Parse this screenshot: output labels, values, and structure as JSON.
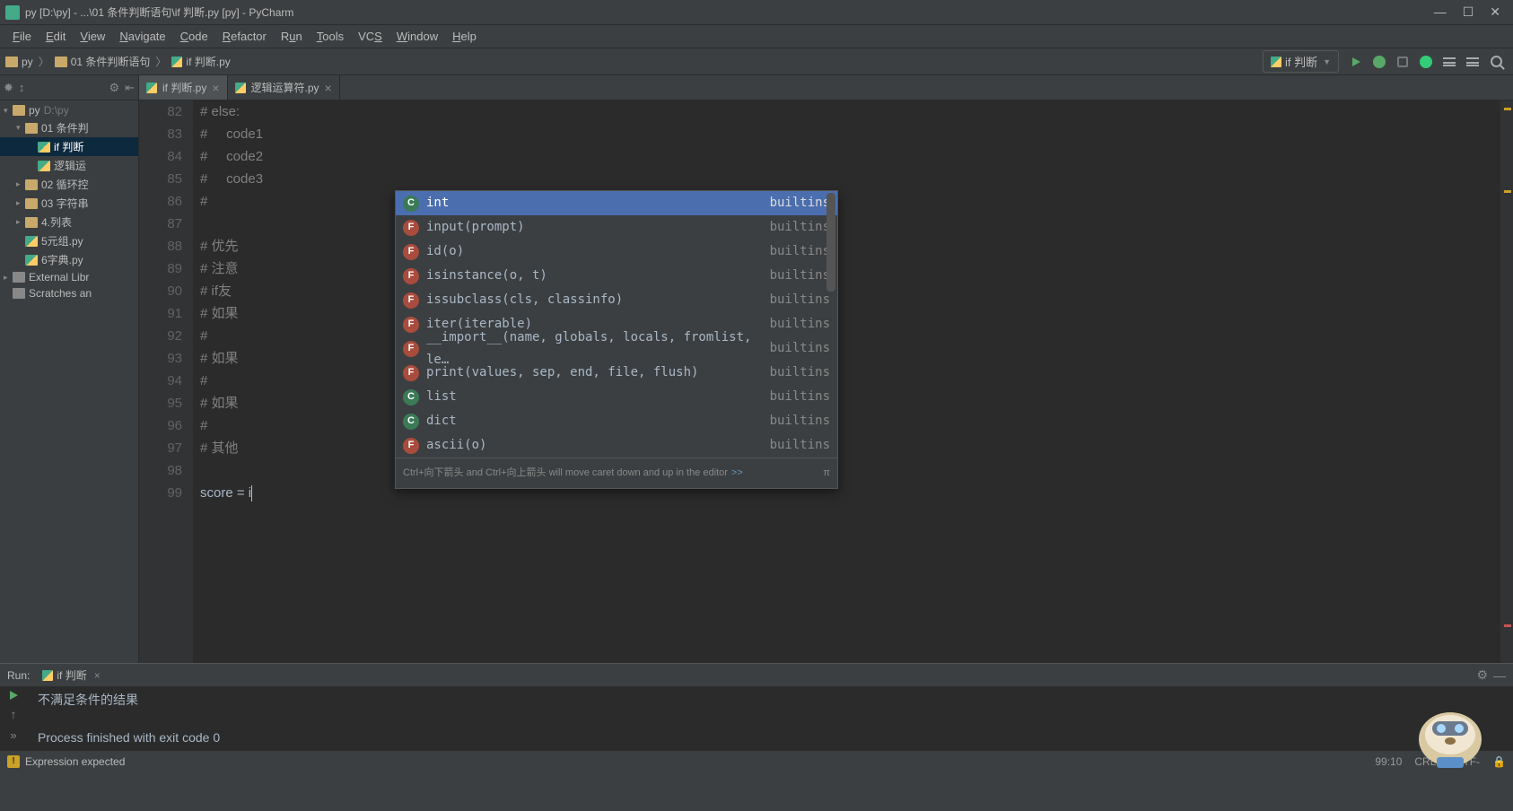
{
  "window": {
    "title": "py [D:\\py] - ...\\01 条件判断语句\\if 判断.py [py] - PyCharm"
  },
  "menu": [
    "File",
    "Edit",
    "View",
    "Navigate",
    "Code",
    "Refactor",
    "Run",
    "Tools",
    "VCS",
    "Window",
    "Help"
  ],
  "breadcrumbs": [
    "py",
    "01 条件判断语句",
    "if 判断.py"
  ],
  "run_config": "if 判断",
  "tabs": [
    {
      "name": "if 判断.py",
      "active": true
    },
    {
      "name": "逻辑运算符.py",
      "active": false
    }
  ],
  "project_tree": [
    {
      "level": 0,
      "kind": "folder",
      "label": "py",
      "dim": "D:\\py",
      "chev": "▾"
    },
    {
      "level": 1,
      "kind": "folder",
      "label": "01 条件判",
      "chev": "▾"
    },
    {
      "level": 2,
      "kind": "pyfile",
      "label": "if 判断",
      "selected": true
    },
    {
      "level": 2,
      "kind": "pyfile",
      "label": "逻辑运"
    },
    {
      "level": 1,
      "kind": "folder",
      "label": "02 循环控",
      "chev": "▸"
    },
    {
      "level": 1,
      "kind": "folder",
      "label": "03 字符串",
      "chev": "▸"
    },
    {
      "level": 1,
      "kind": "folder",
      "label": "4.列表",
      "chev": "▸"
    },
    {
      "level": 1,
      "kind": "pyfile",
      "label": "5元组.py"
    },
    {
      "level": 1,
      "kind": "pyfile",
      "label": "6字典.py"
    },
    {
      "level": 0,
      "kind": "lib",
      "label": "External Libr",
      "chev": "▸"
    },
    {
      "level": 0,
      "kind": "lib",
      "label": "Scratches an"
    }
  ],
  "gutter_start": 82,
  "code_lines": [
    "# else:",
    "#     code1",
    "#     code2",
    "#     code3",
    "#",
    "",
    "# 优先",
    "# 注意",
    "# if友",
    "# 如果",
    "#",
    "# 如果",
    "#",
    "# 如果",
    "#",
    "# 其他",
    "",
    "score = i"
  ],
  "completion": {
    "selected_index": 0,
    "items": [
      {
        "kind": "c",
        "name": "int",
        "src": "builtins"
      },
      {
        "kind": "f",
        "name": "input(prompt)",
        "src": "builtins"
      },
      {
        "kind": "f",
        "name": "id(o)",
        "src": "builtins"
      },
      {
        "kind": "f",
        "name": "isinstance(o, t)",
        "src": "builtins"
      },
      {
        "kind": "f",
        "name": "issubclass(cls, classinfo)",
        "src": "builtins"
      },
      {
        "kind": "f",
        "name": "iter(iterable)",
        "src": "builtins"
      },
      {
        "kind": "f",
        "name": "__import__(name, globals, locals, fromlist, le…",
        "src": "builtins"
      },
      {
        "kind": "f",
        "name": "print(values, sep, end, file, flush)",
        "src": "builtins"
      },
      {
        "kind": "c",
        "name": "list",
        "src": "builtins"
      },
      {
        "kind": "c",
        "name": "dict",
        "src": "builtins"
      },
      {
        "kind": "f",
        "name": "ascii(o)",
        "src": "builtins"
      }
    ],
    "hint": "Ctrl+向下箭头 and Ctrl+向上箭头 will move caret down and up in the editor",
    "hint_link": ">>",
    "hint_pi": "π"
  },
  "run_output": {
    "title": "Run:",
    "tab": "if 判断",
    "lines": [
      "不满足条件的结果",
      "",
      "Process finished with exit code 0"
    ]
  },
  "status": {
    "msg": "Expression expected",
    "pos": "99:10",
    "eol": "CRLF",
    "enc": "UTF-"
  }
}
